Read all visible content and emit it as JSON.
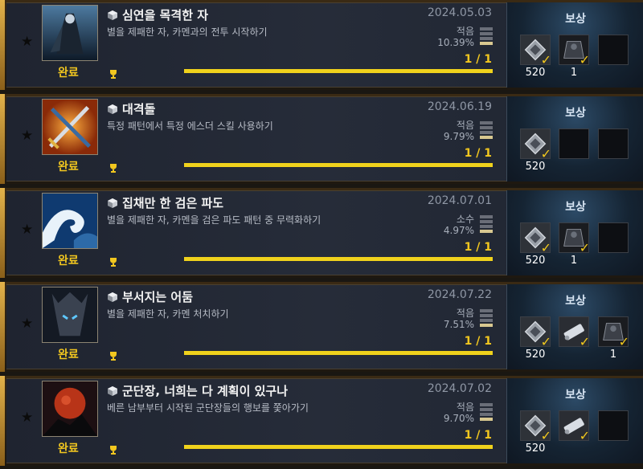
{
  "colors": {
    "gold": "#f2c71f",
    "progress": "#f0d21c",
    "panel": "#1f2430"
  },
  "reward_header": "보상",
  "rows": [
    {
      "title": "심연을 목격한 자",
      "desc": "별을 제패한 자, 카멘과의 전투 시작하기",
      "date": "2024.05.03",
      "rarity": "적음",
      "percent": "10.39%",
      "progress": "1 / 1",
      "progress_fraction": 1.0,
      "status": "완료",
      "icon": "dark-knight-icon",
      "rewards": [
        {
          "icon": "title-badge-icon",
          "count": "520",
          "checked": true
        },
        {
          "icon": "dark-armor-icon",
          "count": "1",
          "checked": true
        },
        {
          "icon": "",
          "count": "",
          "checked": false
        }
      ]
    },
    {
      "title": "대격돌",
      "desc": "특정 패턴에서 특정 에스더 스킬 사용하기",
      "date": "2024.06.19",
      "rarity": "적음",
      "percent": "9.79%",
      "progress": "1 / 1",
      "progress_fraction": 1.0,
      "status": "완료",
      "icon": "crossed-swords-icon",
      "rewards": [
        {
          "icon": "title-badge-icon",
          "count": "520",
          "checked": true
        },
        {
          "icon": "",
          "count": "",
          "checked": false
        },
        {
          "icon": "",
          "count": "",
          "checked": false
        }
      ]
    },
    {
      "title": "집채만 한 검은 파도",
      "desc": "별을 제패한 자, 카멘을 검은 파도 패턴 중 무력화하기",
      "date": "2024.07.01",
      "rarity": "소수",
      "percent": "4.97%",
      "progress": "1 / 1",
      "progress_fraction": 1.0,
      "status": "완료",
      "icon": "wave-icon",
      "rewards": [
        {
          "icon": "title-badge-icon",
          "count": "520",
          "checked": true
        },
        {
          "icon": "dark-armor-icon",
          "count": "1",
          "checked": true
        },
        {
          "icon": "",
          "count": "",
          "checked": false
        }
      ]
    },
    {
      "title": "부서지는 어둠",
      "desc": "별을 제패한 자, 카멘 처치하기",
      "date": "2024.07.22",
      "rarity": "적음",
      "percent": "7.51%",
      "progress": "1 / 1",
      "progress_fraction": 1.0,
      "status": "완료",
      "icon": "dark-helm-icon",
      "rewards": [
        {
          "icon": "title-badge-icon",
          "count": "520",
          "checked": true
        },
        {
          "icon": "scroll-icon",
          "count": "",
          "checked": true
        },
        {
          "icon": "dark-armor-icon",
          "count": "1",
          "checked": true
        }
      ]
    },
    {
      "title": "군단장, 너희는 다 계획이 있구나",
      "desc": "베른 남부부터 시작된 군단장들의 행보를 쫓아가기",
      "date": "2024.07.02",
      "rarity": "적음",
      "percent": "9.70%",
      "progress": "1 / 1",
      "progress_fraction": 1.0,
      "status": "완료",
      "icon": "red-moon-icon",
      "rewards": [
        {
          "icon": "title-badge-icon",
          "count": "520",
          "checked": true
        },
        {
          "icon": "scroll-icon",
          "count": "",
          "checked": true
        },
        {
          "icon": "",
          "count": "",
          "checked": false
        }
      ]
    }
  ]
}
